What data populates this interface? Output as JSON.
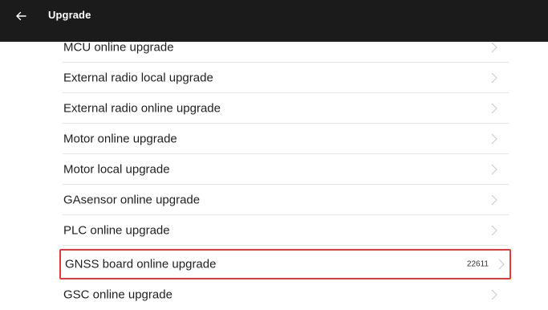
{
  "header": {
    "title": "Upgrade"
  },
  "items": [
    {
      "label": "MCU online upgrade",
      "value": ""
    },
    {
      "label": "External radio local upgrade",
      "value": ""
    },
    {
      "label": "External radio online upgrade",
      "value": ""
    },
    {
      "label": "Motor online upgrade",
      "value": ""
    },
    {
      "label": "Motor local upgrade",
      "value": ""
    },
    {
      "label": "GAsensor online upgrade",
      "value": ""
    },
    {
      "label": "PLC online upgrade",
      "value": ""
    },
    {
      "label": "GNSS board online upgrade",
      "value": "22611"
    },
    {
      "label": "GSC online upgrade",
      "value": ""
    }
  ],
  "colors": {
    "header_bg": "#1b1b1b",
    "highlight_border": "#e53935",
    "chevron": "#c8c8c8"
  },
  "icons": {
    "back": "arrow-left-icon",
    "item_chevron": "chevron-right-icon"
  }
}
